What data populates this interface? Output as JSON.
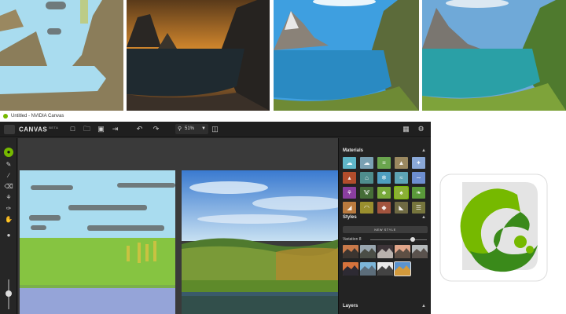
{
  "window": {
    "title": "Untitled - NVIDIA Canvas"
  },
  "toolbar": {
    "brand": "CANVAS",
    "beta": "BETA",
    "zoom_value": "51%",
    "icons": [
      "new-file-icon",
      "open-folder-icon",
      "save-icon",
      "export-icon",
      "undo-icon",
      "redo-icon",
      "zoom-icon",
      "compare-layout-icon",
      "feedback-icon",
      "settings-icon"
    ]
  },
  "tools": [
    "brush-icon",
    "line-icon",
    "eraser-icon",
    "fill-icon",
    "eyedropper-icon",
    "pan-hand-icon"
  ],
  "panel": {
    "materials_title": "Materials",
    "styles_title": "Styles",
    "new_style_label": "NEW STYLE",
    "variation_label": "Variation 8",
    "layers_title": "Layers",
    "variation_value": 0.75,
    "selected_material": 13
  },
  "colors": {
    "nvidia_green": "#76b900",
    "paint_sky": "#a9dcef",
    "paint_grass": "#86c441",
    "paint_water": "#95a4d8",
    "paint_cloud": "#6f7a7c",
    "paint_tree": "#c9c241"
  },
  "materials": [
    {
      "icon": "sky-icon",
      "color": "#5fb6c8"
    },
    {
      "icon": "cloud-icon",
      "color": "#7aa1b3"
    },
    {
      "icon": "grass-icon",
      "color": "#6aa54e"
    },
    {
      "icon": "mountain-icon",
      "color": "#9a8860"
    },
    {
      "icon": "sparkle-icon",
      "color": "#8aa8d8"
    },
    {
      "icon": "fire-icon",
      "color": "#b24d2c"
    },
    {
      "icon": "house-icon",
      "color": "#4e8d8d"
    },
    {
      "icon": "snow-icon",
      "color": "#4e9ec0"
    },
    {
      "icon": "water-icon",
      "color": "#5da4b5"
    },
    {
      "icon": "wave-icon",
      "color": "#6d8ed0"
    },
    {
      "icon": "flower-icon",
      "color": "#8a3ea0"
    },
    {
      "icon": "plant-icon",
      "color": "#456d37"
    },
    {
      "icon": "bush-icon",
      "color": "#77a83a"
    },
    {
      "icon": "tree-icon",
      "color": "#8ab034"
    },
    {
      "icon": "leaf-icon",
      "color": "#5a9a3a"
    },
    {
      "icon": "dune-icon",
      "color": "#b97a3e"
    },
    {
      "icon": "hill-icon",
      "color": "#9a8f2e"
    },
    {
      "icon": "rock-icon",
      "color": "#a2543e"
    },
    {
      "icon": "cliff-icon",
      "color": "#6f6a43"
    },
    {
      "icon": "field-icon",
      "color": "#76753d"
    }
  ],
  "styles": [
    {
      "sky": "#c97a4a",
      "land": "#3c3530"
    },
    {
      "sky": "#9aa7b0",
      "land": "#4b4e46"
    },
    {
      "sky": "#3d3438",
      "land": "#b9b2ad"
    },
    {
      "sky": "#e0a58a",
      "land": "#5e4f44"
    },
    {
      "sky": "#b7bcbd",
      "land": "#5a524d"
    },
    {
      "sky": "#d7733c",
      "land": "#2d2a33"
    },
    {
      "sky": "#7db6d9",
      "land": "#5c6d7a"
    },
    {
      "sky": "#e9e9e9",
      "land": "#434343"
    },
    {
      "sky": "#5a93cf",
      "land": "#d39a3c"
    }
  ],
  "selected_style": 8
}
